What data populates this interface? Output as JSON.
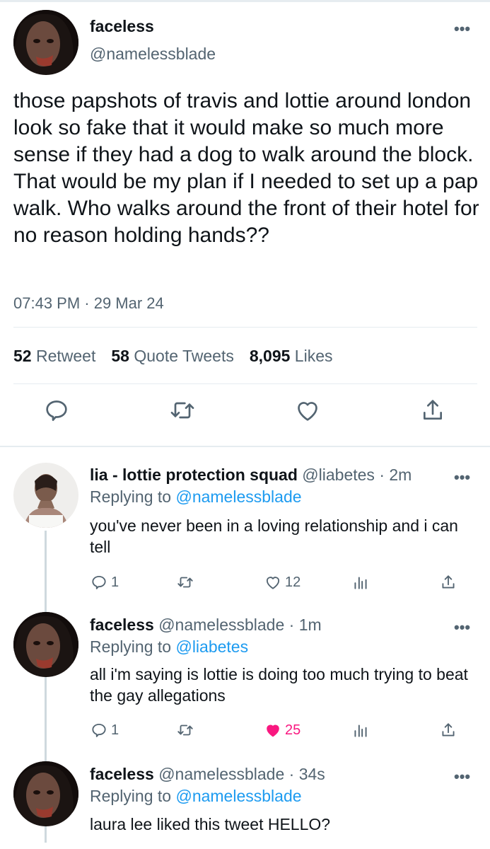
{
  "main_tweet": {
    "display_name": "faceless",
    "handle": "@namelessblade",
    "text": "those papshots of travis and lottie around london look so fake that it would make so much more sense if they had a dog to walk around the block. That would be my plan if I needed to set up a pap walk. Who walks around the front of their hotel for no reason holding hands??",
    "timestamp": "07:43 PM · 29 Mar 24",
    "retweets_count": "52",
    "retweets_label": "Retweet",
    "quotes_count": "58",
    "quotes_label": "Quote Tweets",
    "likes_count": "8,095",
    "likes_label": "Likes",
    "icons": [
      "reply-icon",
      "retweet-icon",
      "like-icon",
      "share-icon"
    ]
  },
  "replies": [
    {
      "display_name": "lia - lottie protection squad",
      "handle": "@liabetes",
      "time": "· 2m",
      "replying_prefix": "Replying to",
      "replying_to": "@namelessblade",
      "text": "you've never been in a loving relationship and i can tell",
      "reply_count": "1",
      "like_count": "12",
      "liked": false
    },
    {
      "display_name": "faceless",
      "handle": "@namelessblade",
      "time": "· 1m",
      "replying_prefix": "Replying to",
      "replying_to": "@liabetes",
      "text": "all i'm saying is lottie is doing too much trying to beat the gay allegations",
      "reply_count": "1",
      "like_count": "25",
      "liked": true
    },
    {
      "display_name": "faceless",
      "handle": "@namelessblade",
      "time": "· 34s",
      "replying_prefix": "Replying to",
      "replying_to": "@namelessblade",
      "text": "laura lee liked this tweet HELLO?"
    }
  ],
  "colors": {
    "accent": "#1d9bf0",
    "like": "#f91880",
    "secondary_text": "#536471",
    "primary_text": "#0f1419"
  }
}
